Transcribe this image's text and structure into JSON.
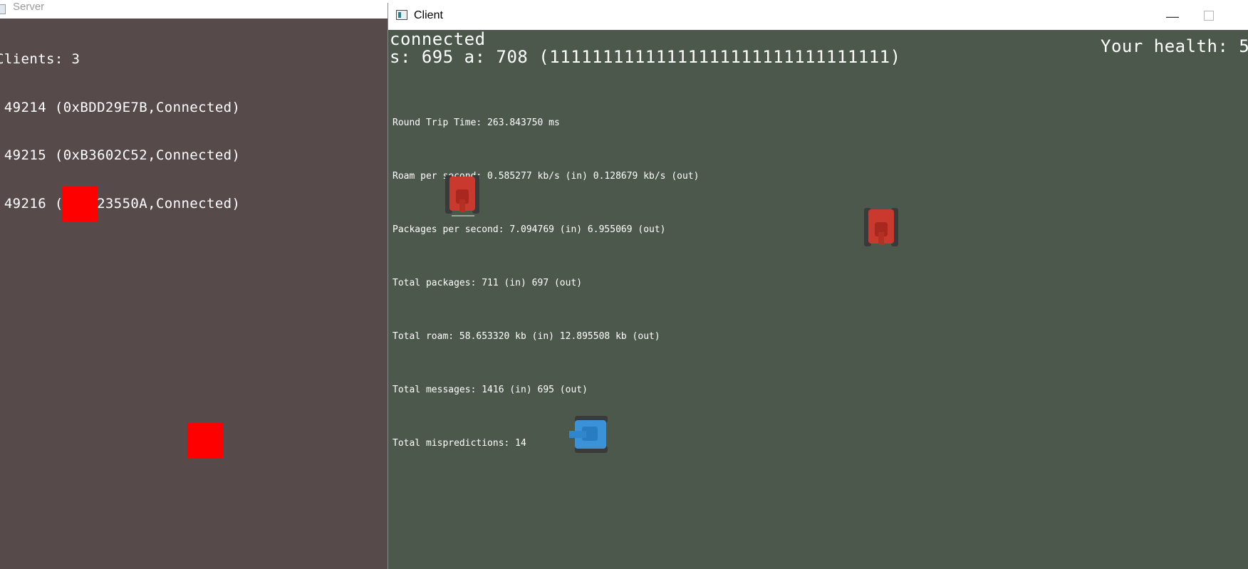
{
  "server": {
    "title": "Server",
    "lines": [
      "Clients: 3",
      " 49214 (0xBDD29E7B,Connected)",
      " 49215 (0xB3602C52,Connected)",
      " 49216 (0xA123550A,Connected)"
    ]
  },
  "client": {
    "title": "Client",
    "minimize_glyph": "—",
    "status": "connected",
    "seq_line": "s: 695 a: 708 (11111111111111111111111111111111)",
    "health": "Your health: 5",
    "stats": [
      "Round Trip Time: 263.843750 ms",
      "Roam per second: 0.585277 kb/s (in) 0.128679 kb/s (out)",
      "Packages per second: 7.094769 (in) 6.955069 (out)",
      "Total packages: 711 (in) 697 (out)",
      "Total roam: 58.653320 kb (in) 12.895508 kb (out)",
      "Total messages: 1416 (in) 695 (out)",
      "Total mispredictions: 14"
    ]
  },
  "colors": {
    "server_bg": "#574a4b",
    "client_bg": "#4c584b",
    "server_entity": "#ff0000",
    "enemy_tank": "#c9392d",
    "player_tank": "#3b92d8"
  },
  "icons": {
    "server_window": "window-icon",
    "client_window": "window-icon"
  }
}
